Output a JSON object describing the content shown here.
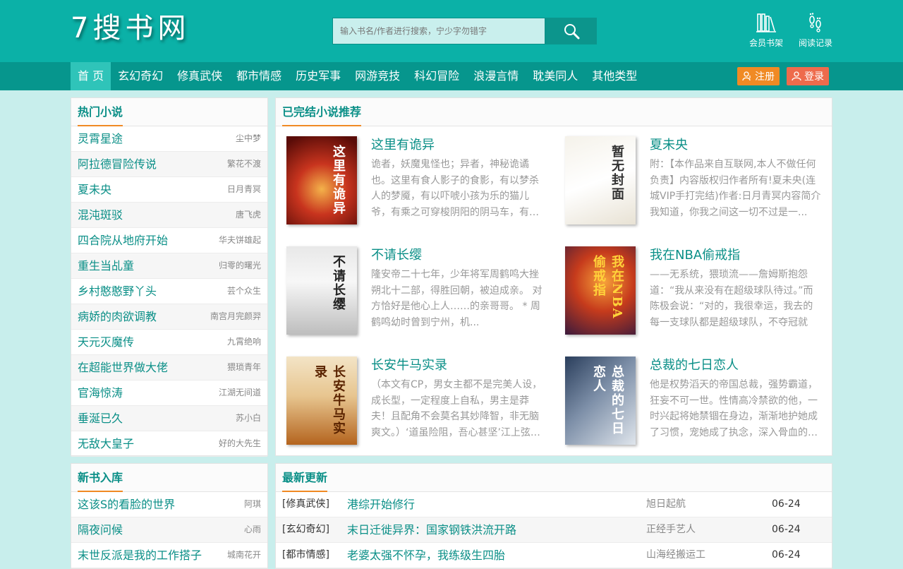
{
  "site": {
    "logo": "7搜书网",
    "search_placeholder": "输入书名/作者进行搜索，宁少字勿错字",
    "header_links": [
      {
        "label": "会员书架",
        "icon": "bookshelf-icon"
      },
      {
        "label": "阅读记录",
        "icon": "footprints-icon"
      }
    ]
  },
  "nav": {
    "items": [
      "首 页",
      "玄幻奇幻",
      "修真武侠",
      "都市情感",
      "历史军事",
      "网游竞技",
      "科幻冒险",
      "浪漫言情",
      "耽美同人",
      "其他类型"
    ],
    "register": "注册",
    "login": "登录"
  },
  "colors": {
    "header": "#0bb1a7",
    "nav": "#06968d",
    "accent": "#0a8f87",
    "orange": "#f08a24",
    "background": "#c8eeec"
  },
  "hot": {
    "title": "热门小说",
    "items": [
      {
        "title": "灵霄星途",
        "author": "尘中梦"
      },
      {
        "title": "阿拉德冒险传说",
        "author": "繁花不渡"
      },
      {
        "title": "夏未央",
        "author": "日月青冥"
      },
      {
        "title": "混沌斑驳",
        "author": "唐飞虎"
      },
      {
        "title": "四合院从地府开始",
        "author": "华夫饼雄起"
      },
      {
        "title": "重生当乩童",
        "author": "归零的曙光"
      },
      {
        "title": "乡村憨憨野丫头",
        "author": "芸个众生"
      },
      {
        "title": "病娇的肉欲调教",
        "author": "南宫月完颜羿"
      },
      {
        "title": "天元灭魔传",
        "author": "九霄绝响"
      },
      {
        "title": "在超能世界做大佬",
        "author": "猥琐青年"
      },
      {
        "title": "官海惊涛",
        "author": "江湖无间道"
      },
      {
        "title": "垂涎已久",
        "author": "苏小白"
      },
      {
        "title": "无敌大皇子",
        "author": "好的大先生"
      }
    ]
  },
  "completed": {
    "title": "已完结小说推荐",
    "books": [
      {
        "title": "这里有诡异",
        "desc": "诡者，妖魔鬼怪也；异者，神秘诡谲也。这里有食人影子的食影，有以梦杀人的梦魇，有以吓唬小孩为乐的猫儿爷，有乘之可穿梭阴阳的阴马车，有…",
        "cover_text": "这里有诡异"
      },
      {
        "title": "夏未央",
        "desc": "附：【本作品来自互联网,本人不做任何负责】内容版权归作者所有!夏未央(连城VIP手打完结)作者:日月青冥内容简介我知道，你我之间这一切不过是一...",
        "cover_text": "暂无封面"
      },
      {
        "title": "不请长缨",
        "desc": "隆安帝二十七年，少年将军周鹤鸣大挫朔北十二部，得胜回朝，被迫成亲。 对方恰好是他心上人……的亲哥哥。 * 周鹤鸣幼时曾到宁州，机...",
        "cover_text": "不请长缨"
      },
      {
        "title": "我在NBA偷戒指",
        "desc": "——无系统，猥琐流——詹姆斯抱怨道：“我从来没有在超级球队待过。”而陈极会说：“对的，我很幸运，我去的每一支球队都是超级球队，不夺冠就失…",
        "cover_text": "我在NBA偷戒指"
      },
      {
        "title": "长安牛马实录",
        "desc": "（本文有CP，男女主都不是完美人设，成长型，一定程度上自私，男主是莽夫！且配角不会莫名其妙降智，非无脑爽文。）‘道虽险阻，吾心甚坚’江上弦…",
        "cover_text": "长安牛马实录"
      },
      {
        "title": "总裁的七日恋人",
        "desc": "他是权势滔天的帝国总裁，强势霸道，狂妄不可一世。性情高冷禁欲的他，一时兴起将她禁锢在身边，渐渐地护她成了习惯，宠她成了执念，深入骨血的…",
        "cover_text": "总裁的七日恋人"
      }
    ]
  },
  "new_books": {
    "title": "新书入库",
    "items": [
      {
        "title": "这该S的看脸的世界",
        "author": "阿琪"
      },
      {
        "title": "隔夜问候",
        "author": "心雨"
      },
      {
        "title": "末世反派是我的工作搭子",
        "author": "城南花开"
      }
    ]
  },
  "latest": {
    "title": "最新更新",
    "rows": [
      {
        "category": "[修真武侠]",
        "title": "港综开始修行",
        "author": "旭日起航",
        "date": "06-24"
      },
      {
        "category": "[玄幻奇幻]",
        "title": "末日迁徙异界：国家钢铁洪流开路",
        "author": "正经手艺人",
        "date": "06-24"
      },
      {
        "category": "[都市情感]",
        "title": "老婆太强不怀孕，我练级生四胎",
        "author": "山海经搬运工",
        "date": "06-24"
      }
    ]
  }
}
